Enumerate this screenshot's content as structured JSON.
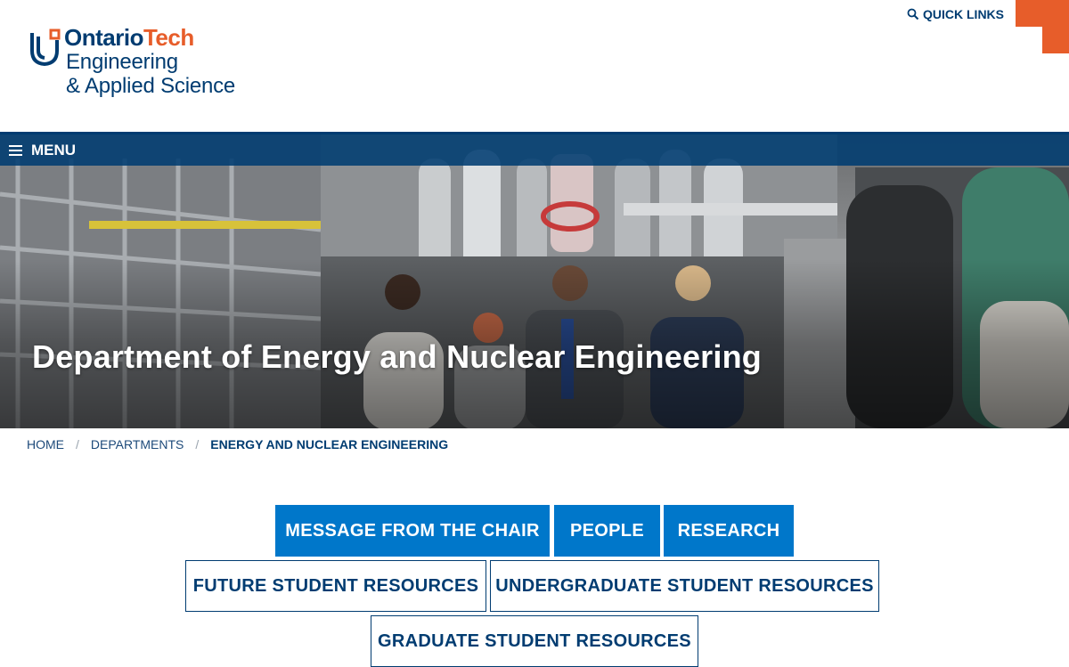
{
  "header": {
    "logo": {
      "brand_part1": "Ontario",
      "brand_part2": "Tech",
      "line1": "Engineering",
      "line2": "& Applied Science"
    },
    "quick_links_label": "QUICK LINKS",
    "quick_links_icon": "search-icon"
  },
  "hero": {
    "menu_label": "MENU",
    "menu_icon": "hamburger-icon",
    "title": "Department of Energy and Nuclear Engineering"
  },
  "breadcrumb": {
    "items": [
      "HOME",
      "DEPARTMENTS",
      "ENERGY AND NUCLEAR ENGINEERING"
    ],
    "separator": "/"
  },
  "nav_buttons": {
    "message_from_chair": "MESSAGE FROM THE CHAIR",
    "people": "PEOPLE",
    "research": "RESEARCH",
    "future_student_resources": "FUTURE STUDENT RESOURCES",
    "undergraduate_student_resources": "UNDERGRADUATE STUDENT RESOURCES",
    "graduate_student_resources": "GRADUATE STUDENT RESOURCES"
  },
  "colors": {
    "navy": "#003c71",
    "orange": "#e75d2a",
    "primary_blue": "#0077ca"
  }
}
